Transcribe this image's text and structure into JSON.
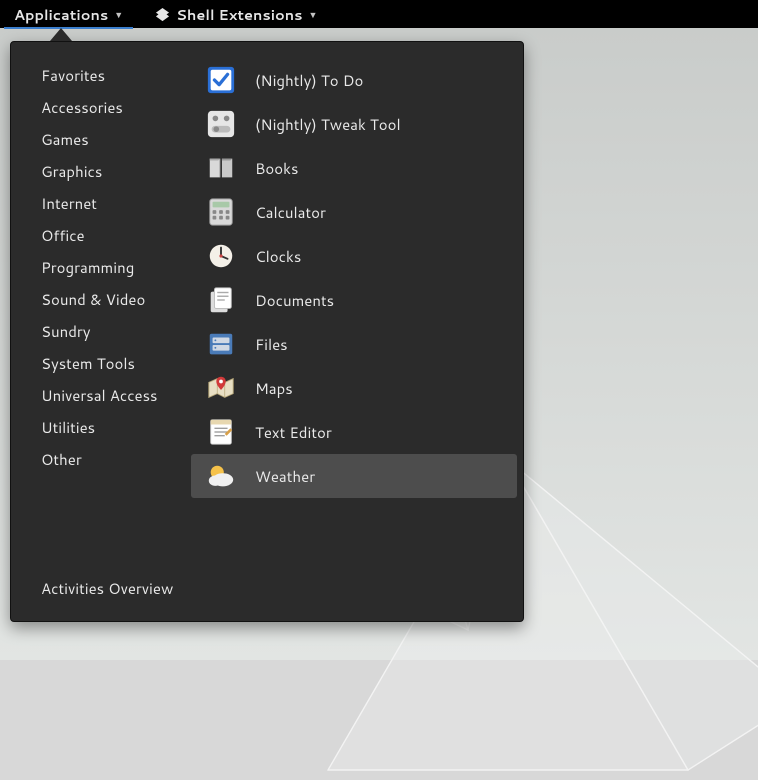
{
  "topbar": {
    "applications_label": "Applications",
    "shell_extensions_label": "Shell Extensions"
  },
  "categories": [
    "Favorites",
    "Accessories",
    "Games",
    "Graphics",
    "Internet",
    "Office",
    "Programming",
    "Sound & Video",
    "Sundry",
    "System Tools",
    "Universal Access",
    "Utilities",
    "Other"
  ],
  "apps": [
    {
      "label": "(Nightly) To Do",
      "icon": "todo"
    },
    {
      "label": "(Nightly) Tweak Tool",
      "icon": "tweak"
    },
    {
      "label": "Books",
      "icon": "books"
    },
    {
      "label": "Calculator",
      "icon": "calculator"
    },
    {
      "label": "Clocks",
      "icon": "clocks"
    },
    {
      "label": "Documents",
      "icon": "documents"
    },
    {
      "label": "Files",
      "icon": "files"
    },
    {
      "label": "Maps",
      "icon": "maps"
    },
    {
      "label": "Text Editor",
      "icon": "texteditor"
    },
    {
      "label": "Weather",
      "icon": "weather",
      "highlighted": true
    }
  ],
  "footer": {
    "activities_overview": "Activities Overview"
  }
}
